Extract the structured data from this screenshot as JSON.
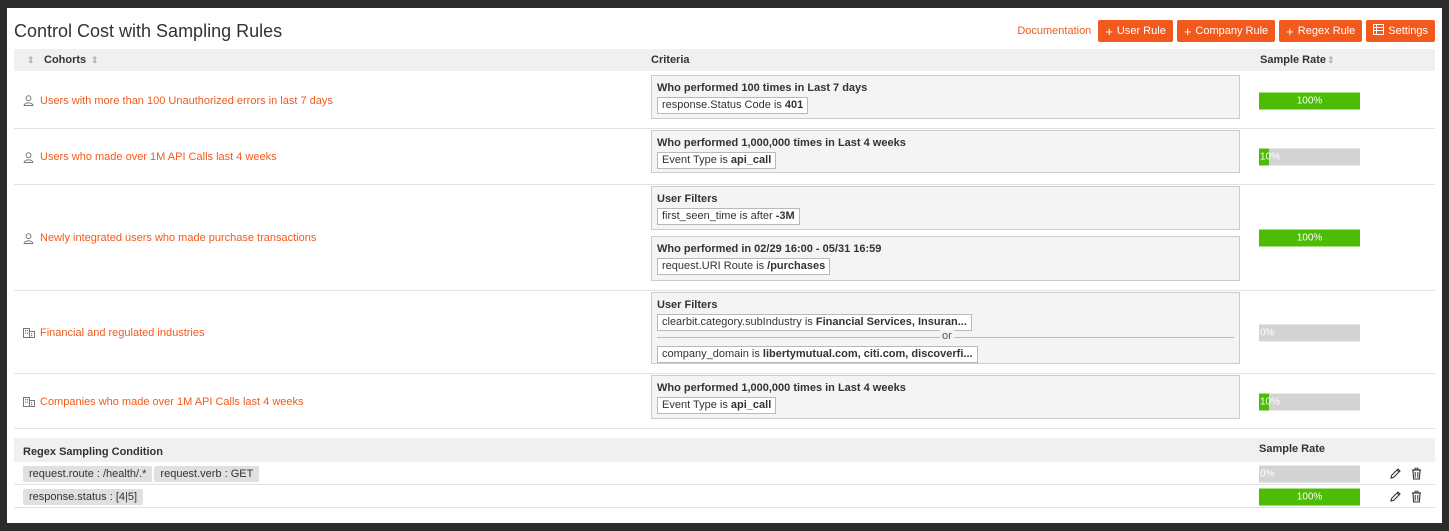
{
  "header": {
    "title": "Control Cost with Sampling Rules",
    "documentation_label": "Documentation",
    "buttons": [
      {
        "label": "User Rule",
        "icon": "plus-icon"
      },
      {
        "label": "Company Rule",
        "icon": "plus-icon"
      },
      {
        "label": "Regex Rule",
        "icon": "plus-icon"
      },
      {
        "label": "Settings",
        "icon": "table-icon"
      }
    ]
  },
  "table": {
    "columns": [
      "Cohorts",
      "Criteria",
      "Sample Rate"
    ],
    "rows": [
      {
        "cohort": "Users with more than 100 Unauthorized errors in last 7 days",
        "type_icon": "user-icon",
        "criteria": [
          {
            "title": "Who performed 100 times in Last 7 days",
            "chips": [
              {
                "label": "response.Status Code is ",
                "value": "401"
              }
            ]
          }
        ],
        "sample_rate": "100%",
        "rate": 100
      },
      {
        "cohort": "Users who made over 1M API Calls last 4 weeks",
        "type_icon": "user-icon",
        "criteria": [
          {
            "title": "Who performed 1,000,000 times in Last 4 weeks",
            "chips": [
              {
                "label": "Event Type is ",
                "value": "api_call"
              }
            ]
          }
        ],
        "sample_rate": "10%",
        "rate": 10
      },
      {
        "cohort": "Newly integrated users who made purchase transactions",
        "type_icon": "user-icon",
        "criteria": [
          {
            "title": "User Filters",
            "chips": [
              {
                "label": "first_seen_time is after ",
                "value": "-3M"
              }
            ]
          },
          {
            "title": "Who performed in 02/29 16:00 - 05/31 16:59",
            "chips": [
              {
                "label": "request.URI Route is ",
                "value": "/purchases"
              }
            ]
          }
        ],
        "sample_rate": "100%",
        "rate": 100
      },
      {
        "cohort": "Financial and regulated industries",
        "type_icon": "building-icon",
        "criteria": [
          {
            "title": "User Filters",
            "or_label": "or",
            "chips": [
              {
                "label": "clearbit.category.subIndustry is ",
                "value": "Financial Services, Insuran..."
              },
              {
                "label": "company_domain is ",
                "value": "libertymutual.com, citi.com, discoverfi..."
              }
            ]
          }
        ],
        "sample_rate": "0%",
        "rate": 0
      },
      {
        "cohort": "Companies who made over 1M API Calls last 4 weeks",
        "type_icon": "building-icon",
        "criteria": [
          {
            "title": "Who performed 1,000,000 times in Last 4 weeks",
            "chips": [
              {
                "label": "Event Type is ",
                "value": "api_call"
              }
            ]
          }
        ],
        "sample_rate": "10%",
        "rate": 10
      }
    ]
  },
  "regex": {
    "columns": [
      "Regex Sampling Condition",
      "Sample Rate"
    ],
    "rows": [
      {
        "tags": [
          "request.route : /health/.*",
          "request.verb : GET"
        ],
        "sample_rate": "0%",
        "rate": 0
      },
      {
        "tags": [
          "response.status : [4|5]"
        ],
        "sample_rate": "100%",
        "rate": 100
      }
    ]
  },
  "colors": {
    "accent": "#f25a1d",
    "bar_fill": "#4cbc05",
    "bar_track": "#d3d3d3"
  }
}
